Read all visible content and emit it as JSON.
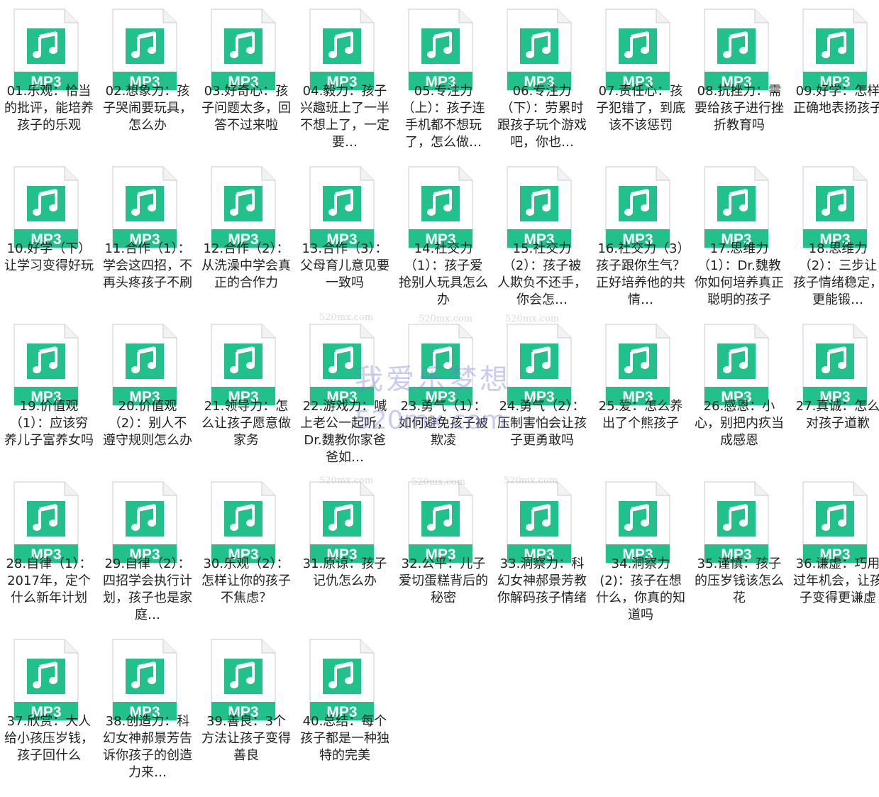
{
  "icon": {
    "name": "music-note-icon",
    "badge": "MP3",
    "color": "#22c08a"
  },
  "watermark": {
    "title": "我爱乐梦想",
    "url": "520mx.com",
    "small": "520mx.com"
  },
  "files": [
    {
      "name": "01.乐观：恰当的批评，能培养孩子的乐观"
    },
    {
      "name": "02.想象力：孩子哭闹要玩具，怎么办"
    },
    {
      "name": "03.好奇心：孩子问题太多，回答不过来啦"
    },
    {
      "name": "04.毅力：孩子兴趣班上了一半不想上了，一定要…"
    },
    {
      "name": "05.专注力（上）：孩子连手机都不想玩了，怎么做…"
    },
    {
      "name": "06.专注力（下）：劳累时跟孩子玩个游戏吧，你也…"
    },
    {
      "name": "07.责任心：孩子犯错了，到底该不该惩罚"
    },
    {
      "name": "08.抗挫力：需要给孩子进行挫折教育吗"
    },
    {
      "name": "09.好学：怎样正确地表扬孩子"
    },
    {
      "name": "10.好学（下）让学习变得好玩"
    },
    {
      "name": "11.合作（1）：学会这四招，不再头疼孩子不刷"
    },
    {
      "name": "12.合作（2）：从洗澡中学会真正的合作力"
    },
    {
      "name": "13.合作（3）：父母育儿意见要一致吗"
    },
    {
      "name": "14.社交力（1）：孩子爱抢别人玩具怎么办"
    },
    {
      "name": "15.社交力（2）：孩子被人欺负不还手，你会怎…"
    },
    {
      "name": "16.社交力（3）孩子跟你生气？正好培养他的共情…"
    },
    {
      "name": "17.思维力（1）：Dr.魏教你如何培养真正聪明的孩子"
    },
    {
      "name": "18.思维力（2）：三步让孩子情绪稳定，更能锻…"
    },
    {
      "name": "19.价值观（1）：应该穷养儿子富养女吗"
    },
    {
      "name": "20.价值观（2）：别人不遵守规则怎么办"
    },
    {
      "name": "21.领导力：怎么让孩子愿意做家务"
    },
    {
      "name": "22.游戏力：喊上老公一起听，Dr.魏教你家爸爸如…"
    },
    {
      "name": "23.勇气（1）：如何避免孩子被欺凌"
    },
    {
      "name": "24.勇气（2）：压制害怕会让孩子更勇敢吗"
    },
    {
      "name": "25.爱：怎么养出了个熊孩子"
    },
    {
      "name": "26.感恩：小心，别把内疚当成感恩"
    },
    {
      "name": "27.真诚：怎么对孩子道歉"
    },
    {
      "name": "28.自律（1）：2017年，定个什么新年计划"
    },
    {
      "name": "29.自律（2）：四招学会执行计划，孩子也是家庭…"
    },
    {
      "name": "30.乐观（2）：怎样让你的孩子不焦虑？"
    },
    {
      "name": "31.原谅：孩子记仇怎么办"
    },
    {
      "name": "32.公平：儿子爱切蛋糕背后的秘密"
    },
    {
      "name": "33.洞察力：科幻女神郝景芳教你解码孩子情绪"
    },
    {
      "name": "34.洞察力 (2)：孩子在想什么，你真的知道吗"
    },
    {
      "name": "35.谨慎：孩子的压岁钱该怎么花"
    },
    {
      "name": "36.谦虚：巧用过年机会，让孩子变得更谦虚"
    },
    {
      "name": "37.欣赏：大人给小孩压岁钱，孩子回什么"
    },
    {
      "name": "38.创造力：科幻女神郝景芳告诉你孩子的创造力来…"
    },
    {
      "name": "39.善良：3个方法让孩子变得善良"
    },
    {
      "name": "40.总结：每个孩子都是一种独特的完美"
    }
  ]
}
